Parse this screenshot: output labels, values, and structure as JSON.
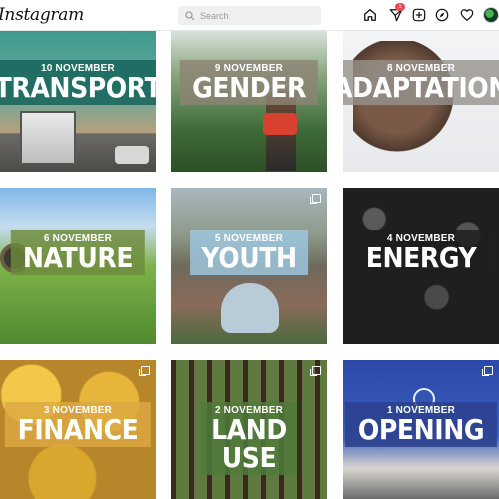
{
  "app": {
    "logo": "Instagram"
  },
  "search": {
    "placeholder": "Search"
  },
  "nav": {
    "icons": [
      "home-icon",
      "direct-message-icon",
      "new-post-icon",
      "explore-icon",
      "activity-heart-icon",
      "profile-avatar"
    ],
    "badge": "1"
  },
  "colors": {
    "badge": "#ed4956"
  },
  "posts": [
    {
      "date": "10 NOVEMBER",
      "title": "TRANSPORT",
      "box": "#1a6b5f"
    },
    {
      "date": "9 NOVEMBER",
      "title": "GENDER",
      "box": "#8c8474"
    },
    {
      "date": "8 NOVEMBER",
      "title": "ADAPTATION",
      "box": "#9a9590"
    },
    {
      "date": "6 NOVEMBER",
      "title": "NATURE",
      "box": "#6d8a3a"
    },
    {
      "date": "5 NOVEMBER",
      "title": "YOUTH",
      "box": "#9ec8e0"
    },
    {
      "date": "4 NOVEMBER",
      "title": "ENERGY",
      "box": "#2b2b2b"
    },
    {
      "date": "3 NOVEMBER",
      "title": "FINANCE",
      "box": "#d9a640"
    },
    {
      "date": "2 NOVEMBER",
      "title": "LAND USE",
      "box": "#4f7a3b"
    },
    {
      "date": "1 NOVEMBER",
      "title": "OPENING",
      "box": "#2b3f8c"
    }
  ]
}
